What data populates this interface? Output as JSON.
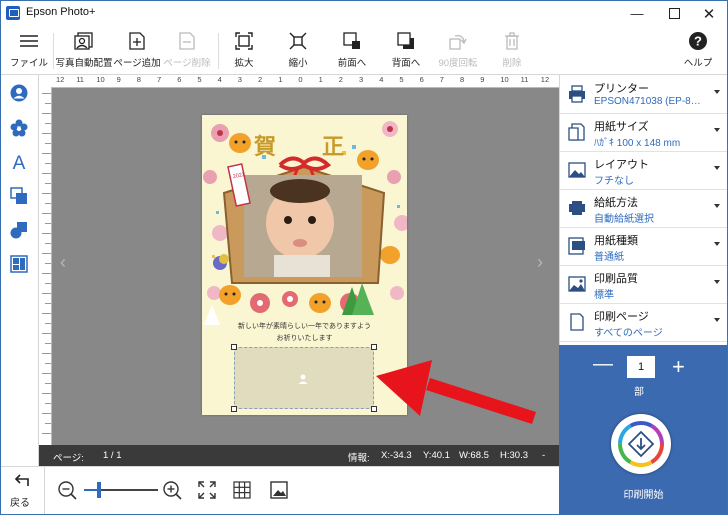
{
  "window": {
    "title": "Epson Photo+"
  },
  "toolbar": {
    "file": "ファイル",
    "auto_layout": "写真自動配置",
    "add_page": "ページ追加",
    "delete_page": "ページ削除",
    "zoom_in": "拡大",
    "zoom_out": "縮小",
    "to_front": "前面へ",
    "to_back": "背面へ",
    "rotate90": "90度回転",
    "delete": "削除",
    "help": "ヘルプ"
  },
  "ruler": {
    "top": [
      "12",
      "11",
      "10",
      "9",
      "8",
      "7",
      "6",
      "5",
      "4",
      "3",
      "2",
      "1",
      "0",
      "1",
      "2",
      "3",
      "4",
      "5",
      "6",
      "7",
      "8",
      "9",
      "10",
      "11",
      "12"
    ]
  },
  "card": {
    "title_left": "賀",
    "title_right": "正",
    "tag": "2022",
    "message_line1": "新しい年が素晴らしい一年でありますよう",
    "message_line2": "お祈りいたします"
  },
  "status": {
    "page_label": "ページ:",
    "page_value": "1 / 1",
    "info_label": "情報:",
    "x": "X:-34.3",
    "y": "Y:40.1",
    "w": "W:68.5",
    "h": "H:30.3",
    "dash": "-"
  },
  "bottom": {
    "back": "戻る"
  },
  "settings": [
    {
      "title": "プリンター",
      "value": "EPSON471038 (EP-8…"
    },
    {
      "title": "用紙サイズ",
      "value": "ﾊｶﾞｷ 100 x 148 mm"
    },
    {
      "title": "レイアウト",
      "value": "フチなし"
    },
    {
      "title": "給紙方法",
      "value": "自動給紙選択"
    },
    {
      "title": "用紙種類",
      "value": "普通紙"
    },
    {
      "title": "印刷品質",
      "value": "標準"
    },
    {
      "title": "印刷ページ",
      "value": "すべてのページ"
    }
  ],
  "print": {
    "copies": "1",
    "copies_unit": "部",
    "minus": "—",
    "plus": "+",
    "start": "印刷開始"
  },
  "colors": {
    "accent": "#2e6bbf",
    "print_panel": "#3c6ab0",
    "arrow": "#e8141c"
  }
}
